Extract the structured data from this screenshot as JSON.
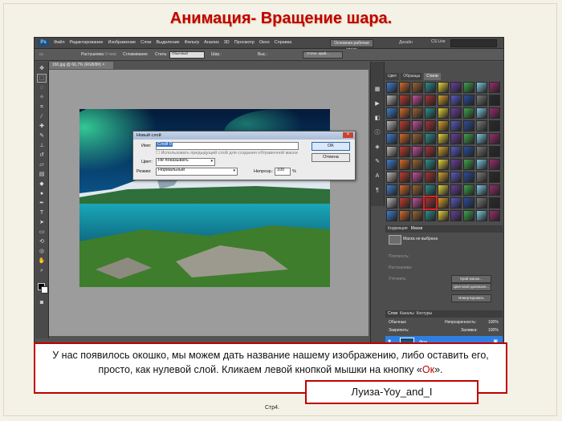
{
  "slide": {
    "title": "Анимация- Вращение шара.",
    "caption_text": "У нас появилось окошко, мы можем дать название нашему изображению, либо оставить его, просто, как нулевой слой.   Кликаем левой кнопкой мышки на кнопку «",
    "caption_highlight": "Ок",
    "caption_end": "».",
    "author": "Луиза-Yoy_and_I",
    "page": "Стр4."
  },
  "photoshop": {
    "logo": "Ps",
    "menu": [
      "Файл",
      "Редактирование",
      "Изображение",
      "Слои",
      "Выделение",
      "Фильтр",
      "Анализ",
      "3D",
      "Просмотр",
      "Окно",
      "Справка"
    ],
    "workspace_button": "Основная рабочая среда",
    "design_link": "Дизайн",
    "cs_live": "CS Live",
    "options": {
      "feather_label": "Растушевка:",
      "feather_value": "0 пикс",
      "antialias": "Сглаживание",
      "style_label": "Стиль:",
      "style_value": "Обычный",
      "width_label": "Шир.:",
      "height_label": "Выс.:",
      "refine_button": "Уточн. край..."
    },
    "document_tab": "160.jpg @ 66,7% (RGB/8#) ×",
    "panel_tabs": [
      "Цвет",
      "Образцы",
      "Стили"
    ],
    "active_panel_tab": "Стили",
    "adjustments": {
      "tabs": [
        "Коррекция",
        "Маски"
      ],
      "mask_label": "Маска не выбрана",
      "density_label": "Плотность:",
      "feather_label": "Растушевка:",
      "refine_label": "Уточнить:",
      "buttons": [
        "Край маски...",
        "Цветовой диапазон...",
        "Инвертировать"
      ]
    },
    "layers": {
      "tabs": [
        "Слои",
        "Каналы",
        "Контуры"
      ],
      "blend_mode": "Обычные",
      "opacity_label": "Непрозрачность:",
      "opacity_value": "100%",
      "lock_label": "Закрепить:",
      "fill_label": "Заливка:",
      "fill_value": "100%",
      "layer_name": "Фон"
    }
  },
  "dialog": {
    "title": "Новый слой",
    "name_label": "Имя:",
    "name_value": "Слой 0",
    "clip_checkbox": "Использовать предыдущий слой для создания обтравочной маски",
    "color_label": "Цвет:",
    "color_value": "Не показывать",
    "mode_label": "Режим:",
    "mode_value": "Нормальный",
    "opacity_label": "Непрозр.:",
    "opacity_value": "100",
    "opacity_unit": "%",
    "ok_button": "OK",
    "cancel_button": "Отмена"
  },
  "colors": {
    "title_red": "#c00000",
    "box_border": "#c00000",
    "ps_dark": "#535353",
    "selected_layer": "#2f7fe0"
  }
}
